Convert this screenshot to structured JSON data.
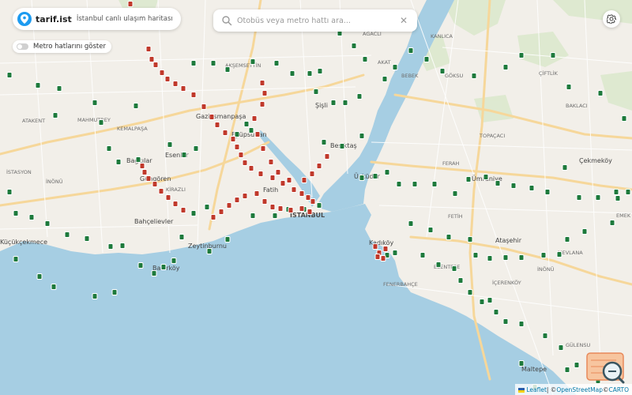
{
  "app": {
    "brand_name": "tarif.ist",
    "brand_subtitle": "İstanbul canlı ulaşım haritası",
    "metro_toggle_label": "Metro hatlarını göster",
    "metro_toggle_on": false
  },
  "search": {
    "placeholder": "Otobüs veya metro hattı ara...",
    "value": ""
  },
  "attribution": {
    "leaflet": "Leaflet",
    "separator": " | © ",
    "osm": "OpenStreetMap",
    "carto_prefix": " © ",
    "carto": "CARTO"
  },
  "colors": {
    "land": "#f2efe9",
    "water": "#a6cee3",
    "park": "#d8e8c8",
    "bus_stop": "#1e7a3c",
    "tram_stop": "#c0392b",
    "accent": "#1d9bf0"
  },
  "labels": {
    "city": "İSTANBUL",
    "districts": [
      "Gaziosmanpaşa",
      "Eyüpsultan",
      "Esenler",
      "Bağcılar",
      "Güngören",
      "Bahçelievler",
      "Fatih",
      "Zeytinburnu",
      "Bakırköy",
      "Beşiktaş",
      "Şişli",
      "Üsküdar",
      "Kadıköy",
      "Ataşehir",
      "Ümraniye",
      "Çekmeköy",
      "Maltepe",
      "Küçükçekmece"
    ],
    "neighborhoods": [
      "AKŞEMSETTİN",
      "MAHMUTBEY",
      "KEMALPAŞA",
      "ATAKENT",
      "İSTASYON",
      "İNÖNÜ",
      "KANLICA",
      "AKAT",
      "BEBEK",
      "GÖKSU",
      "ÇİFTLİK",
      "BAKLACI",
      "TOPAÇACI",
      "FERAH",
      "FETİH",
      "MEVLANA",
      "İNÖNÜ",
      "İÇERENKÖY",
      "GÜLENSU",
      "ESENTEPE",
      "FENERBAHÇE",
      "EMEK",
      "AĞACLI",
      "KİRAZLI"
    ]
  },
  "icons": {
    "logo": "location-pin-icon",
    "search": "search-icon",
    "clear": "close-icon",
    "settings": "gear-icon",
    "zoom": "zoom-magnifier-icon",
    "bus_marker": "bus-icon",
    "tram_marker": "tram-icon"
  }
}
